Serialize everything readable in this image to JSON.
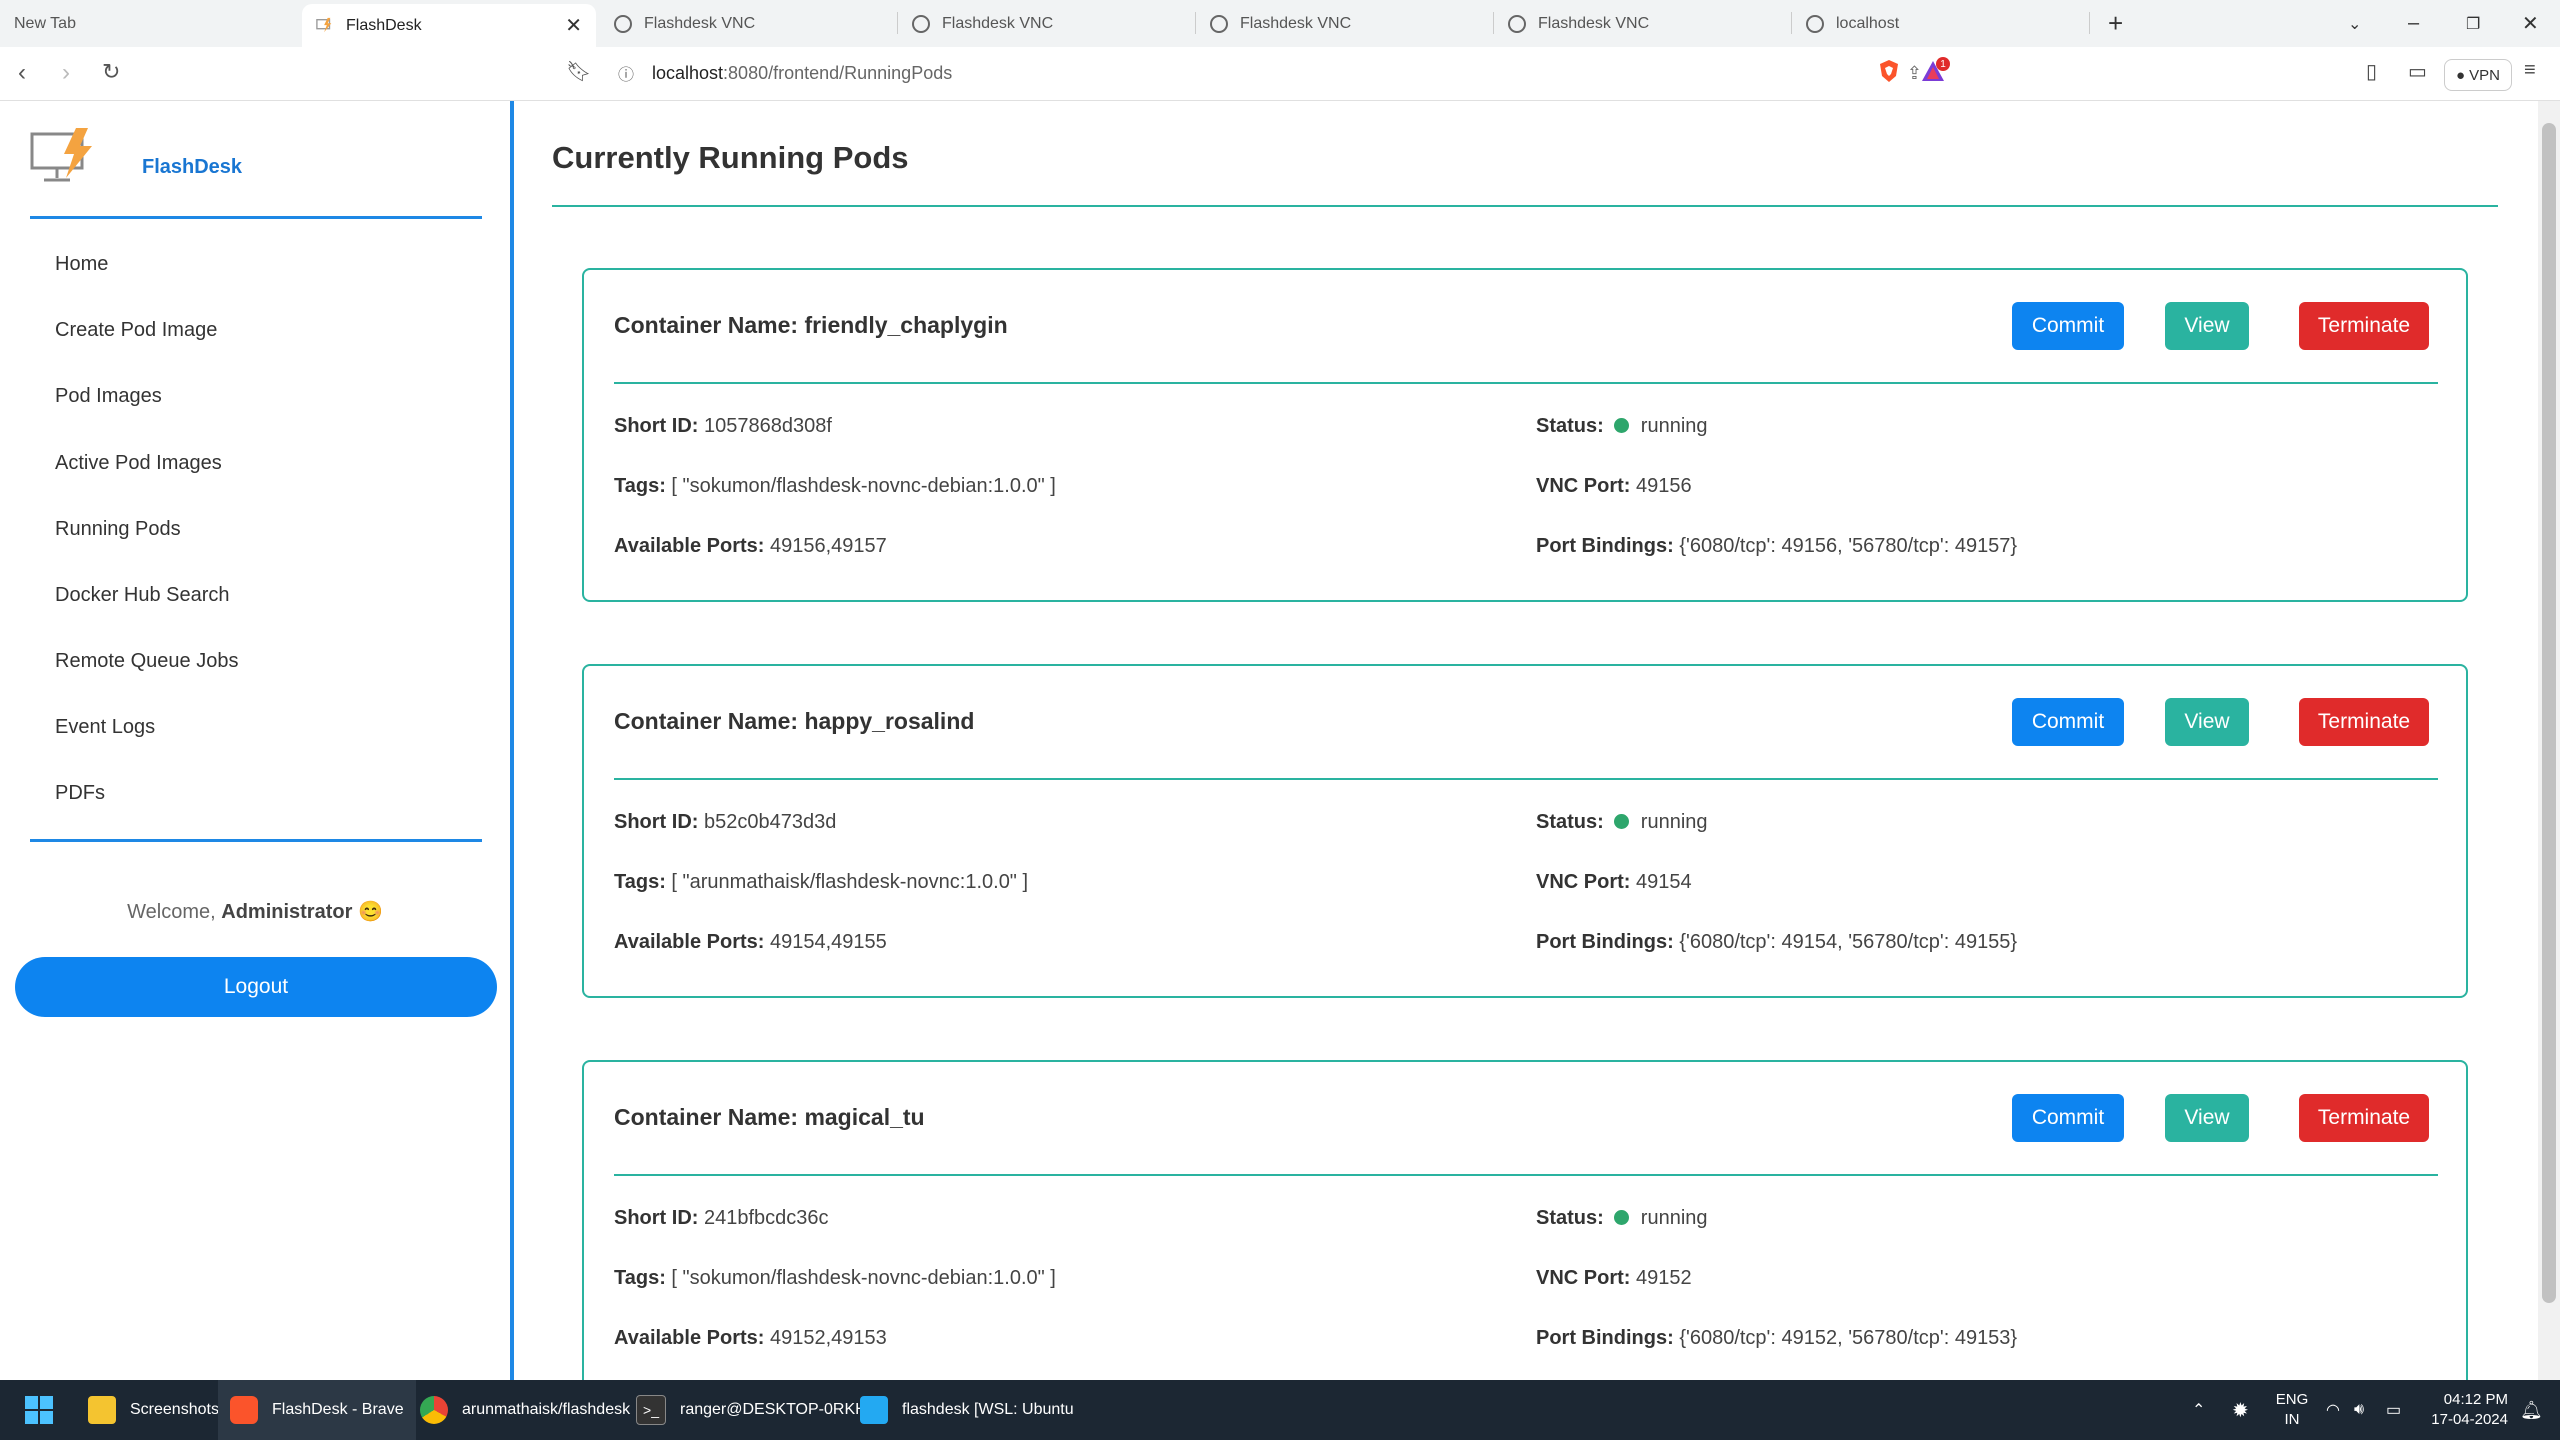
{
  "browser": {
    "tabs": [
      {
        "title": "New Tab",
        "active": false
      },
      {
        "title": "FlashDesk",
        "active": true
      },
      {
        "title": "Flashdesk VNC",
        "active": false
      },
      {
        "title": "Flashdesk VNC",
        "active": false
      },
      {
        "title": "Flashdesk VNC",
        "active": false
      },
      {
        "title": "Flashdesk VNC",
        "active": false
      },
      {
        "title": "localhost",
        "active": false
      }
    ],
    "url_host": "localhost",
    "url_path": ":8080/frontend/RunningPods",
    "vpn_label": "VPN",
    "notification_count": "1"
  },
  "sidebar": {
    "brand": "FlashDesk",
    "items": [
      {
        "label": "Home"
      },
      {
        "label": "Create Pod Image"
      },
      {
        "label": "Pod Images"
      },
      {
        "label": "Active Pod Images"
      },
      {
        "label": "Running Pods"
      },
      {
        "label": "Docker Hub Search"
      },
      {
        "label": "Remote Queue Jobs"
      },
      {
        "label": "Event Logs"
      },
      {
        "label": "PDFs"
      }
    ],
    "welcome_prefix": "Welcome,",
    "username": "Administrator",
    "welcome_emoji": "😊",
    "logout_label": "Logout"
  },
  "main": {
    "title": "Currently Running Pods",
    "labels": {
      "container_name": "Container Name:",
      "short_id": "Short ID:",
      "tags": "Tags:",
      "available_ports": "Available Ports:",
      "status": "Status:",
      "vnc_port": "VNC Port:",
      "port_bindings": "Port Bindings:"
    },
    "buttons": {
      "commit": "Commit",
      "view": "View",
      "terminate": "Terminate"
    },
    "pods": [
      {
        "name": "friendly_chaplygin",
        "short_id": "1057868d308f",
        "tags": "[ \"sokumon/flashdesk-novnc-debian:1.0.0\" ]",
        "available_ports": "49156,49157",
        "status": "running",
        "vnc_port": "49156",
        "port_bindings": "{'6080/tcp': 49156, '56780/tcp': 49157}"
      },
      {
        "name": "happy_rosalind",
        "short_id": "b52c0b473d3d",
        "tags": "[ \"arunmathaisk/flashdesk-novnc:1.0.0\" ]",
        "available_ports": "49154,49155",
        "status": "running",
        "vnc_port": "49154",
        "port_bindings": "{'6080/tcp': 49154, '56780/tcp': 49155}"
      },
      {
        "name": "magical_tu",
        "short_id": "241bfbcdc36c",
        "tags": "[ \"sokumon/flashdesk-novnc-debian:1.0.0\" ]",
        "available_ports": "49152,49153",
        "status": "running",
        "vnc_port": "49152",
        "port_bindings": "{'6080/tcp': 49152, '56780/tcp': 49153}"
      }
    ]
  },
  "taskbar": {
    "items": [
      {
        "label": "Screenshots",
        "icon": "folder-icon"
      },
      {
        "label": "FlashDesk - Brave",
        "icon": "brave-icon"
      },
      {
        "label": "arunmathaisk/flashdesk",
        "icon": "chrome-icon"
      },
      {
        "label": "ranger@DESKTOP-0RKH",
        "icon": "terminal-icon"
      },
      {
        "label": "flashdesk [WSL: Ubuntu",
        "icon": "vscode-icon"
      }
    ],
    "lang_1": "ENG",
    "lang_2": "IN",
    "time": "04:12 PM",
    "date": "17-04-2024"
  },
  "colors": {
    "accent_teal": "#2ab3a0",
    "primary_blue": "#0d84f0",
    "danger_red": "#e02b2b",
    "status_green": "#2ea66c"
  }
}
